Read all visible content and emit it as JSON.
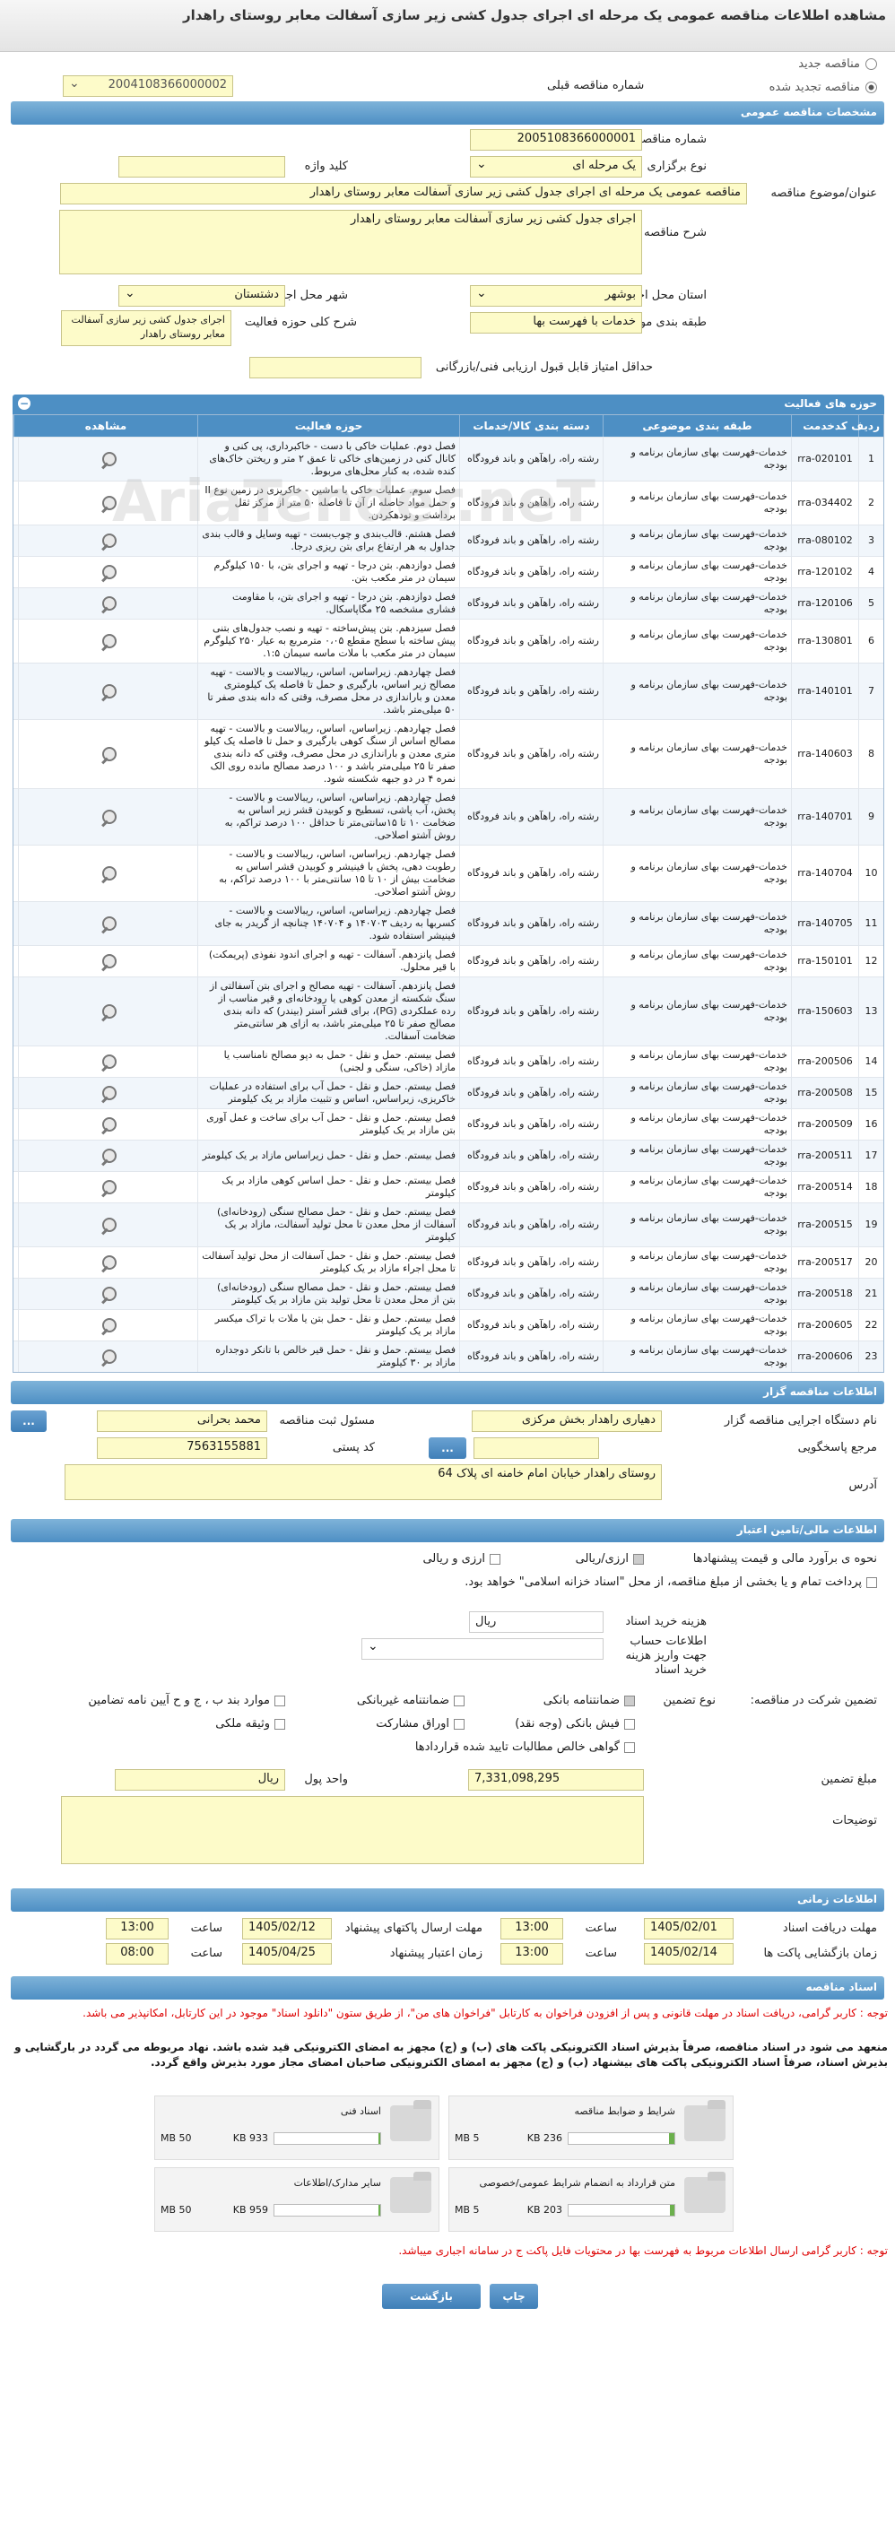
{
  "title": "مشاهده اطلاعات مناقصه عمومی یک مرحله ای اجرای جدول کشی زیر سازی آسفالت معابر روستای راهدار",
  "radios": {
    "new": "مناقصه جدید",
    "renew": "مناقصه تجدید شده"
  },
  "prev_tender": {
    "label": "شماره مناقصه قبلی",
    "value": "2004108366000002"
  },
  "sections": {
    "general": "مشخصات مناقصه عمومی",
    "activities": "حوزه های فعالیت",
    "organizer": "اطلاعات مناقصه گزار",
    "finance": "اطلاعات مالی/تامین اعتبار",
    "timing": "اطلاعات زمانی",
    "documents": "اسناد مناقصه"
  },
  "general": {
    "tender_no_label": "شماره مناقصه",
    "tender_no": "2005108366000001",
    "type_label": "نوع برگزاری",
    "type": "یک مرحله ای",
    "keyword_label": "کلید واژه",
    "keyword": "",
    "subject_label": "عنوان/موضوع مناقصه",
    "subject": "مناقصه عمومی یک مرحله ای اجرای جدول کشی زیر سازی آسفالت معابر روستای راهدار",
    "desc_label": "شرح مناقصه",
    "desc": "اجرای جدول کشی زیر سازی آسفالت معابر روستای راهدار",
    "province_label": "استان محل اجرا",
    "province": "بوشهر",
    "city_label": "شهر محل اجرا",
    "city": "دشتستان",
    "category_label": "طبقه بندی موضوعی",
    "category": "خدمات با فهرست بها",
    "scope_label": "شرح کلی حوزه فعالیت",
    "scope": "اجرای جدول کشی زیر سازی آسفالت معابر روستای راهدار",
    "min_score_label": "حداقل امتیاز قابل قبول ارزیابی فنی/بازرگانی",
    "min_score": ""
  },
  "table": {
    "headers": [
      "ردیف",
      "کدخدمت",
      "طبقه بندی موضوعی",
      "دسته بندی کالا/خدمات",
      "حوزه فعالیت",
      "مشاهده"
    ],
    "cat_text": "خدمات-فهرست بهای سازمان برنامه و بودجه",
    "goods_text": "رشته راه، راهآهن و باند فرودگاه",
    "rows": [
      {
        "n": "1",
        "code": "rra-020101",
        "scope": "فصل دوم. عملیات خاکی با دست - خاکبرداری، پی کنی و کانال کنی در زمین‌های خاکی تا عمق ۲ متر و ریختن خاک‌های کنده شده، به کنار محل‌های مربوط."
      },
      {
        "n": "2",
        "code": "rra-034402",
        "scope": "فصل سوم. عملیات خاکی با ماشین - خاکریزی در زمین نوع II و حمل مواد حاصله از آن تا فاصله ۵۰ متر از مرکز ثقل برداشت و تودهکردن."
      },
      {
        "n": "3",
        "code": "rra-080102",
        "scope": "فصل هشتم. قالب‌بندی و چوب‌بست - تهیه وسایل و قالب بندی جداول به هر ارتفاع برای بتن ریزی درجا."
      },
      {
        "n": "4",
        "code": "rra-120102",
        "scope": "فصل دوازدهم. بتن درجا - تهیه و اجرای بتن، با ۱۵۰ کیلوگرم سیمان در متر مکعب بتن."
      },
      {
        "n": "5",
        "code": "rra-120106",
        "scope": "فصل دوازدهم. بتن درجا - تهیه و اجرای بتن، با مقاومت فشاری مشخصه ۲۵ مگاپاسکال."
      },
      {
        "n": "6",
        "code": "rra-130801",
        "scope": "فصل سیزدهم. بتن پیش‌ساخته - تهیه و نصب جدول‌های بتنی پیش ساخته با سطح مقطع ۰،۰۵ مترمربع به عیار ۲۵۰ کیلوگرم سیمان در متر مکعب با ملات ماسه سیمان ۱:۵."
      },
      {
        "n": "7",
        "code": "rra-140101",
        "scope": "فصل چهاردهم. زیراساس، اساس، ریبالاست و بالاست - تهیه مصالح زیر اساس، بارگیری و حمل تا فاصله یک کیلومتری معدن و باراندازی در محل مصرف، وقتی که دانه بندی صفر تا ۵۰ میلی‌متر باشد."
      },
      {
        "n": "8",
        "code": "rra-140603",
        "scope": "فصل چهاردهم. زیراساس، اساس، ریبالاست و بالاست - تهیه مصالح اساس از سنگ کوهی بارگیری و حمل تا فاصله یک کیلو متری معدن و باراندازی در محل مصرف، وقتی که دانه بندی صفر تا ۲۵ میلی‌متر باشد و ۱۰۰ درصد مصالح مانده روی الک نمره ۴ در دو جبهه شکسته شود."
      },
      {
        "n": "9",
        "code": "rra-140701",
        "scope": "فصل چهاردهم. زیراساس، اساس، ریبالاست و بالاست - پخش، آب پاشی، تسطیح و کوبیدن قشر زیر اساس به ضخامت ۱۰ تا ۱۵سانتی‌متر تا حداقل ۱۰۰ درصد تراکم، به روش آشتو اصلاحی."
      },
      {
        "n": "10",
        "code": "rra-140704",
        "scope": "فصل چهاردهم. زیراساس، اساس، ریبالاست و بالاست - رطوبت دهی، پخش با فینیشر و کوبیدن قشر اساس به ضخامت بیش از ۱۰ تا ۱۵ سانتی‌متر با ۱۰۰ درصد تراکم، به روش آشتو اصلاحی."
      },
      {
        "n": "11",
        "code": "rra-140705",
        "scope": "فصل چهاردهم. زیراساس، اساس، ریبالاست و بالاست - کسربها به ردیف ۱۴۰۷۰۳ و ۱۴۰۷۰۴ چنانچه از گریدر به جای فینیشر استفاده شود."
      },
      {
        "n": "12",
        "code": "rra-150101",
        "scope": "فصل پانزدهم. آسفالت - تهیه و اجرای اندود نفوذی (پریمکت) با قیر محلول."
      },
      {
        "n": "13",
        "code": "rra-150603",
        "scope": "فصل پانزدهم. آسفالت - تهیه مصالح و اجرای بتن آسفالتی از سنگ شکسته از معدن کوهی یا رودخانه‌ای و قیر مناسب از رده عملکردی (PG)، برای قشر آستر (بیندر) که دانه بندی مصالح صفر تا ۲۵ میلی‌متر باشد، به ازای هر سانتی‌متر ضخامت آسفالت."
      },
      {
        "n": "14",
        "code": "rra-200506",
        "scope": "فصل بیستم. حمل و نقل - حمل به دپو مصالح نامناسب یا مازاد (خاکی، سنگی و لجنی)"
      },
      {
        "n": "15",
        "code": "rra-200508",
        "scope": "فصل بیستم. حمل و نقل - حمل آب برای استفاده در عملیات خاکریزی، زیراساس، اساس و تثبیت مازاد بر یک کیلومتر"
      },
      {
        "n": "16",
        "code": "rra-200509",
        "scope": "فصل بیستم. حمل و نقل - حمل آب برای ساخت و عمل آوری بتن مازاد بر یک کیلومتر"
      },
      {
        "n": "17",
        "code": "rra-200511",
        "scope": "فصل بیستم. حمل و نقل - حمل زیراساس مازاد بر یک کیلومتر"
      },
      {
        "n": "18",
        "code": "rra-200514",
        "scope": "فصل بیستم. حمل و نقل - حمل اساس کوهی مازاد بر یک کیلومتر"
      },
      {
        "n": "19",
        "code": "rra-200515",
        "scope": "فصل بیستم. حمل و نقل - حمل مصالح سنگی (رودخانه‌ای) آسفالت از محل معدن تا محل تولید آسفالت، مازاد بر یک کیلومتر"
      },
      {
        "n": "20",
        "code": "rra-200517",
        "scope": "فصل بیستم. حمل و نقل - حمل آسفالت از محل تولید آسفالت تا محل اجراء مازاد بر یک کیلومتر"
      },
      {
        "n": "21",
        "code": "rra-200518",
        "scope": "فصل بیستم. حمل و نقل - حمل مصالح سنگی (رودخانه‌ای) بتن از محل معدن تا محل تولید بتن مازاد بر یک کیلومتر"
      },
      {
        "n": "22",
        "code": "rra-200605",
        "scope": "فصل بیستم. حمل و نقل - حمل بتن یا ملات با تراک میکسر مازاد بر یک کیلومتر"
      },
      {
        "n": "23",
        "code": "rra-200606",
        "scope": "فصل بیستم. حمل و نقل - حمل قیر خالص با تانکر دوجداره مازاد بر ۳۰ کیلومتر"
      }
    ]
  },
  "organizer": {
    "org_label": "نام دستگاه اجرایی مناقصه گزار",
    "org": "دهیاری راهدار بخش مرکزی",
    "officer_label": "مسئول ثبت مناقصه",
    "officer": "محمد بحرانی",
    "ref_label": "مرجع پاسخگویی",
    "ref": "",
    "ref_btn": "...",
    "postal_label": "کد پستی",
    "postal": "7563155881",
    "address_label": "آدرس",
    "address": "روستای راهدار خیابان امام خامنه ای پلاک 64",
    "more_btn": "..."
  },
  "finance": {
    "estimate_label": "نحوه ی برآورد مالی و قیمت پیشنهادها",
    "rial_opt": "ارزی/ریالی",
    "currency_opt": "ارزی و ریالی",
    "payment_note": "پرداخت تمام و یا بخشی از مبلغ مناقصه، از محل \"اسناد خزانه اسلامی\" خواهد بود.",
    "doc_fee_label": "هزینه خرید اسناد",
    "doc_fee_unit": "ریال",
    "account_label": "اطلاعات حساب جهت واریز هزینه خرید اسناد",
    "guarantee_label": "تضمین شرکت در مناقصه:",
    "guarantee_type": "نوع تضمین",
    "opts": [
      "ضمانتنامه بانکی",
      "ضمانتنامه غیربانکی",
      "موارد بند ب ، ج و ح آیین نامه تضامین",
      "فیش بانکی (وجه نقد)",
      "اوراق مشارکت",
      "وثیقه ملکی",
      "گواهی خالص مطالبات تایید شده قراردادها"
    ],
    "amount_label": "مبلغ تضمین",
    "amount": "7,331,098,295",
    "unit_label": "واحد پول",
    "unit": "ریال",
    "notes_label": "توضیحات",
    "notes": ""
  },
  "timing": {
    "doc_receive_label": "مهلت دریافت اسناد",
    "doc_receive_date": "1405/02/01",
    "doc_receive_time": "13:00",
    "submit_label": "مهلت ارسال پاکتهای پیشنهاد",
    "submit_date": "1405/02/12",
    "submit_time": "13:00",
    "open_label": "زمان بازگشایی پاکت ها",
    "open_date": "1405/02/14",
    "open_time": "13:00",
    "valid_label": "زمان اعتبار پیشنهاد",
    "valid_date": "1405/04/25",
    "valid_time": "08:00",
    "time_label": "ساعت"
  },
  "documents": {
    "notice_red": "توجه : کاربر گرامی، دریافت اسناد در مهلت قانونی و پس از افزودن فراخوان به کارتابل \"فراخوان های من\"، از طریق ستون \"دانلود اسناد\" موجود در این کارتابل، امکانپذیر می باشد.",
    "notice_black": "منعهد می شود در اسناد مناقصه، صرفاً بذیرش اسناد الکترونیکی پاکت های (ب) و (ج) مجهز به امضای الکترونیکی قید شده باشد. نهاد مربوطه می گردد در بارگشایی و بذیرش اسناد، صرفاً اسناد الکترونیکی پاکت های بیشنهاد (ب) و (ج) مجهز به امضای الکترونیکی صاحبان امضای مجاز مورد بذیرش واقع گردد.",
    "files": [
      {
        "name": "شرایط و ضوابط مناقصه",
        "size": "236 KB",
        "max": "5 MB",
        "fill": 0.05
      },
      {
        "name": "اسناد فنی",
        "size": "933 KB",
        "max": "50 MB",
        "fill": 0.02
      },
      {
        "name": "متن قرارداد به انضمام شرایط عمومی/خصوصی",
        "size": "203 KB",
        "max": "5 MB",
        "fill": 0.04
      },
      {
        "name": "سایر مدارک/اطلاعات",
        "size": "959 KB",
        "max": "50 MB",
        "fill": 0.02
      }
    ],
    "notice_bottom": "توجه : کاربر گرامی ارسال اطلاعات مربوط به فهرست بها در محتویات فایل پاکت ج در سامانه اجباری میباشد."
  },
  "buttons": {
    "print": "چاپ",
    "back": "بازگشت"
  },
  "watermark": "AriaTender.neT"
}
